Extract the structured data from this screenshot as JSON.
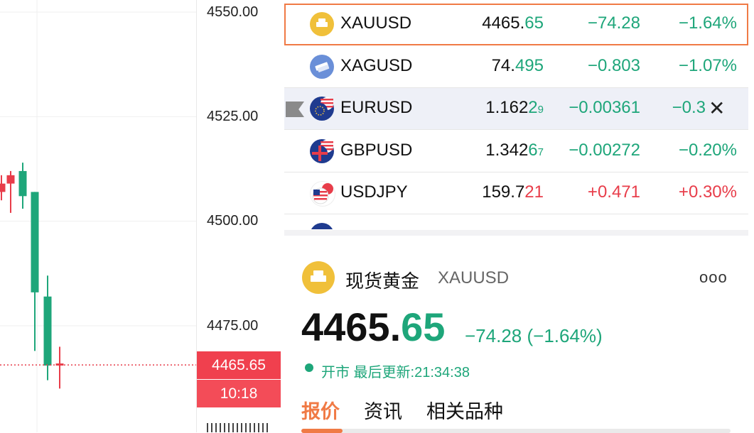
{
  "chart": {
    "axis_ticks": [
      "4550.00",
      "4525.00",
      "4500.00",
      "4475.00"
    ],
    "current_price": "4465.65",
    "countdown": "10:18",
    "colors": {
      "up": "#e83d4a",
      "down": "#1ea67a"
    }
  },
  "chart_data": {
    "type": "candlestick",
    "y_ticks": [
      4550,
      4525,
      4500,
      4475
    ],
    "ylim": [
      4456,
      4553
    ],
    "last_price": 4465.65,
    "candles": [
      {
        "open": 4509,
        "close": 4507,
        "high": 4511,
        "low": 4505,
        "dir": "up"
      },
      {
        "open": 4509,
        "close": 4511,
        "high": 4512,
        "low": 4502,
        "dir": "up"
      },
      {
        "open": 4512,
        "close": 4506,
        "high": 4514,
        "low": 4503,
        "dir": "down"
      },
      {
        "open": 4507,
        "close": 4483,
        "high": 4507,
        "low": 4469,
        "dir": "down"
      },
      {
        "open": 4482,
        "close": 4465.5,
        "high": 4487,
        "low": 4462,
        "dir": "down"
      },
      {
        "open": 4465.5,
        "close": 4466,
        "high": 4470,
        "low": 4460,
        "dir": "up"
      }
    ]
  },
  "watchlist": [
    {
      "symbol": "XAUUSD",
      "price_main": "4465.",
      "price_dec": "65",
      "price_small": "",
      "change": "−74.28",
      "pct": "−1.64%",
      "dir": "down",
      "icon": "gold-bar-icon",
      "icon_color": "#f0c03a"
    },
    {
      "symbol": "XAGUSD",
      "price_main": "74.",
      "price_dec": "495",
      "price_small": "",
      "change": "−0.803",
      "pct": "−1.07%",
      "dir": "down",
      "icon": "silver-bar-icon",
      "icon_color": "#6a8fd8"
    },
    {
      "symbol": "EURUSD",
      "price_main": "1.162",
      "price_dec": "2",
      "price_small": "9",
      "change": "−0.00361",
      "pct": "−0.3",
      "dir": "down",
      "icon": "eu-us-flag-icon",
      "icon_color": "#1f3b8f"
    },
    {
      "symbol": "GBPUSD",
      "price_main": "1.342",
      "price_dec": "6",
      "price_small": "7",
      "change": "−0.00272",
      "pct": "−0.20%",
      "dir": "down",
      "icon": "uk-us-flag-icon",
      "icon_color": "#1f3b8f"
    },
    {
      "symbol": "USDJPY",
      "price_main": "159.7",
      "price_dec": "21",
      "price_small": "",
      "change": "+0.471",
      "pct": "+0.30%",
      "dir": "up",
      "icon": "us-jp-flag-icon",
      "icon_color": "#e83d4a"
    }
  ],
  "detail": {
    "name": "现货黄金",
    "symbol": "XAUUSD",
    "more": "ooo",
    "price_main": "4465.",
    "price_dec": "65",
    "change": "−74.28 (−1.64%)",
    "status": "开市 最后更新:21:34:38",
    "tabs": [
      "报价",
      "资讯",
      "相关品种"
    ]
  }
}
